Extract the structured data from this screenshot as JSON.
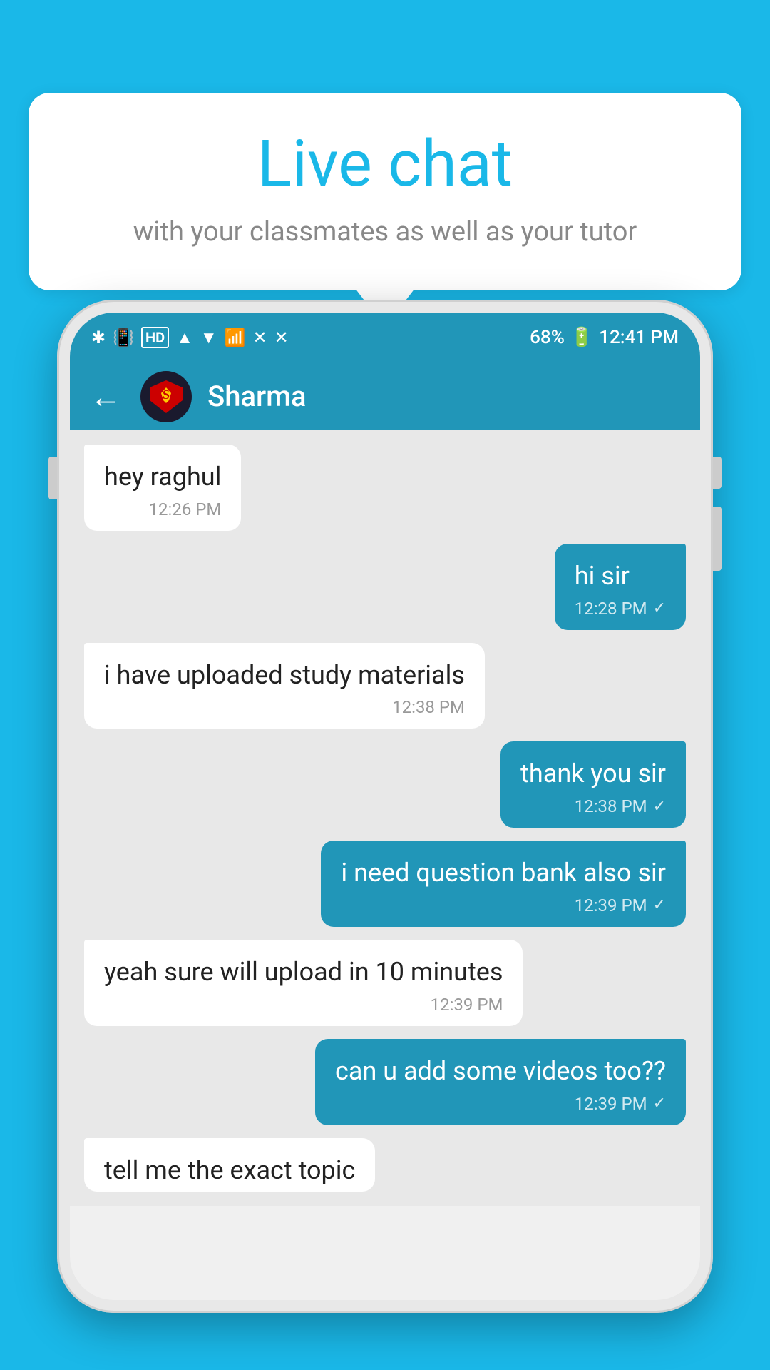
{
  "background_color": "#1ab8e8",
  "speech_bubble": {
    "title": "Live chat",
    "subtitle": "with your classmates as well as your tutor"
  },
  "phone": {
    "status_bar": {
      "time": "12:41 PM",
      "battery_pct": "68%",
      "signal_icons": "🔵📶"
    },
    "chat_header": {
      "contact_name": "Sharma",
      "back_label": "←"
    },
    "messages": [
      {
        "id": "msg1",
        "type": "received",
        "text": "hey raghul",
        "time": "12:26 PM",
        "has_check": false
      },
      {
        "id": "msg2",
        "type": "sent",
        "text": "hi sir",
        "time": "12:28 PM",
        "has_check": true
      },
      {
        "id": "msg3",
        "type": "received",
        "text": "i have uploaded study materials",
        "time": "12:38 PM",
        "has_check": false
      },
      {
        "id": "msg4",
        "type": "sent",
        "text": "thank you sir",
        "time": "12:38 PM",
        "has_check": true
      },
      {
        "id": "msg5",
        "type": "sent",
        "text": "i need question bank also sir",
        "time": "12:39 PM",
        "has_check": true
      },
      {
        "id": "msg6",
        "type": "received",
        "text": "yeah sure will upload in 10 minutes",
        "time": "12:39 PM",
        "has_check": false
      },
      {
        "id": "msg7",
        "type": "sent",
        "text": "can u add some videos too??",
        "time": "12:39 PM",
        "has_check": true
      },
      {
        "id": "msg8",
        "type": "received",
        "text": "tell me the exact topic",
        "time": "",
        "has_check": false,
        "partial": true
      }
    ]
  }
}
